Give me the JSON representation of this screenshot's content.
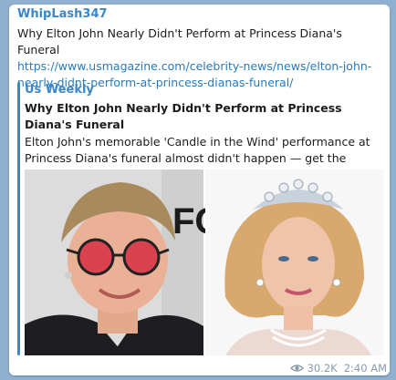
{
  "post": {
    "author": "WhipLash347",
    "text": "Why Elton John Nearly Didn't Perform at Princess Diana's Funeral",
    "link": "https://www.usmagazine.com/celebrity-news/news/elton-john-nearly-didnt-perform-at-princess-dianas-funeral/"
  },
  "preview": {
    "site_name": "Us Weekly",
    "title": "Why Elton John Nearly Didn't Perform at Princess Diana's Funeral",
    "description": "Elton John's memorable 'Candle in the Wind' performance at Princess Diana's funeral almost didn't happen — get the details",
    "backdrop_text": "FOX"
  },
  "meta": {
    "views": "30.2K",
    "time": "2:40 AM"
  },
  "colors": {
    "background": "#8fb0cf",
    "accent": "#3a87c8",
    "link": "#2a7ab8",
    "meta": "#8a9aa9"
  },
  "icons": {
    "views": "eye-icon"
  }
}
